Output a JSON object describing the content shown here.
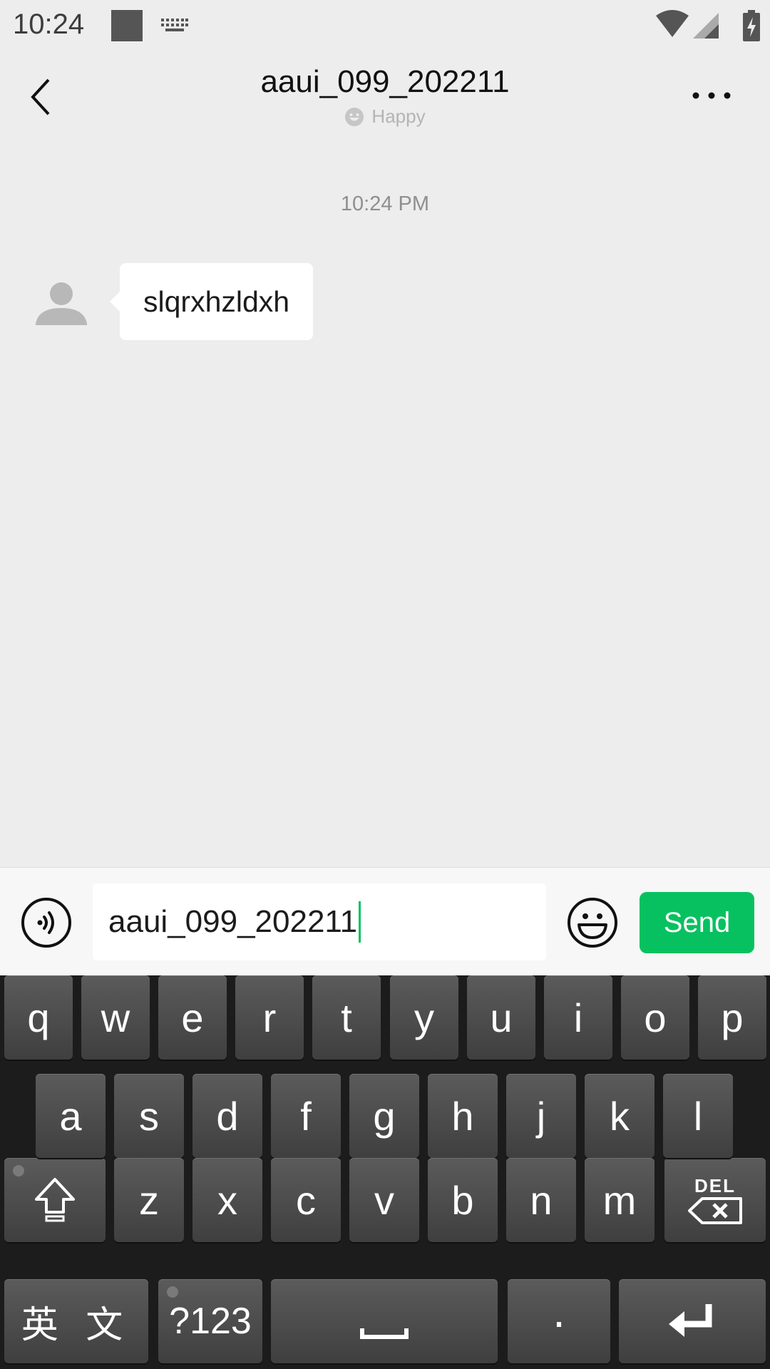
{
  "status_bar": {
    "time": "10:24",
    "icons": [
      "notification-square-icon",
      "keyboard-icon",
      "wifi-icon",
      "signal-icon",
      "battery-charging-icon"
    ]
  },
  "header": {
    "title": "aaui_099_202211",
    "status_icon": "smiley-status-icon",
    "status_text": "Happy",
    "back_icon": "back-arrow-icon",
    "more_icon": "more-options-icon"
  },
  "chat": {
    "timestamp": "10:24 PM",
    "messages": [
      {
        "sender": "contact",
        "avatar_icon": "default-avatar-icon",
        "text": "slqrxhzldxh"
      }
    ]
  },
  "input_bar": {
    "voice_icon": "voice-input-icon",
    "input_value": "aaui_099_202211",
    "emoji_icon": "emoji-icon",
    "send_label": "Send",
    "accent_color": "#07c160"
  },
  "keyboard": {
    "row1": [
      "q",
      "w",
      "e",
      "r",
      "t",
      "y",
      "u",
      "i",
      "o",
      "p"
    ],
    "row2": [
      "a",
      "s",
      "d",
      "f",
      "g",
      "h",
      "j",
      "k",
      "l"
    ],
    "row3": [
      "z",
      "x",
      "c",
      "v",
      "b",
      "n",
      "m"
    ],
    "shift_icon": "shift-icon",
    "delete_label": "DEL",
    "lang_label": "英 文",
    "symbols_label": "?123",
    "space_icon": "space-icon",
    "period_label": "·",
    "enter_icon": "enter-icon"
  }
}
